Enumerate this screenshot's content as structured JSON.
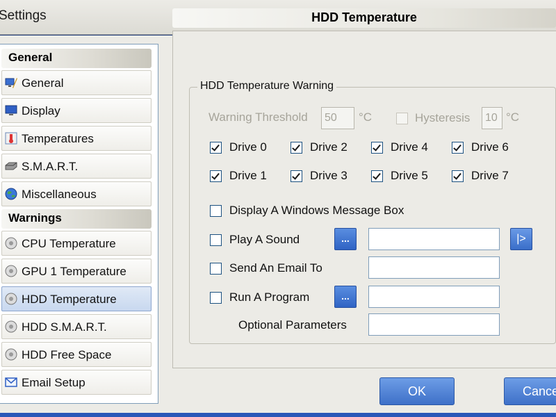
{
  "window": {
    "title": "Settings"
  },
  "sidebar": {
    "sections": [
      {
        "header": "General",
        "items": [
          {
            "label": "General",
            "icon": "monitor-pen-icon"
          },
          {
            "label": "Display",
            "icon": "display-icon"
          },
          {
            "label": "Temperatures",
            "icon": "thermometer-icon"
          },
          {
            "label": "S.M.A.R.T.",
            "icon": "hdd-icon"
          },
          {
            "label": "Miscellaneous",
            "icon": "globe-icon"
          }
        ]
      },
      {
        "header": "Warnings",
        "items": [
          {
            "label": "CPU Temperature",
            "icon": "warning-disc-icon"
          },
          {
            "label": "GPU 1 Temperature",
            "icon": "warning-disc-icon"
          },
          {
            "label": "HDD Temperature",
            "icon": "warning-disc-icon",
            "selected": true
          },
          {
            "label": "HDD S.M.A.R.T.",
            "icon": "warning-disc-icon"
          },
          {
            "label": "HDD Free Space",
            "icon": "warning-disc-icon"
          },
          {
            "label": "Email Setup",
            "icon": "email-icon"
          }
        ]
      }
    ]
  },
  "panel": {
    "title": "HDD Temperature",
    "group_title": "HDD Temperature Warning",
    "threshold": {
      "label": "Warning Threshold",
      "value": "50",
      "unit": "°C"
    },
    "hysteresis": {
      "label": "Hysteresis",
      "value": "10",
      "unit": "°C",
      "checked": false
    },
    "drives": [
      {
        "label": "Drive 0",
        "checked": true
      },
      {
        "label": "Drive 1",
        "checked": true
      },
      {
        "label": "Drive 2",
        "checked": true
      },
      {
        "label": "Drive 3",
        "checked": true
      },
      {
        "label": "Drive 4",
        "checked": true
      },
      {
        "label": "Drive 5",
        "checked": true
      },
      {
        "label": "Drive 6",
        "checked": true
      },
      {
        "label": "Drive 7",
        "checked": true
      }
    ],
    "actions": {
      "message_box": {
        "label": "Display A Windows Message Box",
        "checked": false
      },
      "sound": {
        "label": "Play A Sound",
        "checked": false,
        "browse": "...",
        "value": "",
        "play": "|>"
      },
      "email": {
        "label": "Send An Email To",
        "checked": false,
        "value": ""
      },
      "program": {
        "label": "Run A Program",
        "checked": false,
        "browse": "...",
        "value": ""
      },
      "params": {
        "label": "Optional Parameters",
        "value": ""
      }
    }
  },
  "buttons": {
    "ok": "OK",
    "cancel": "Cancel"
  },
  "colors": {
    "accent": "#3e70c8",
    "window_frame": "#0d2a6e",
    "selected_item": "#c8d8ef"
  }
}
